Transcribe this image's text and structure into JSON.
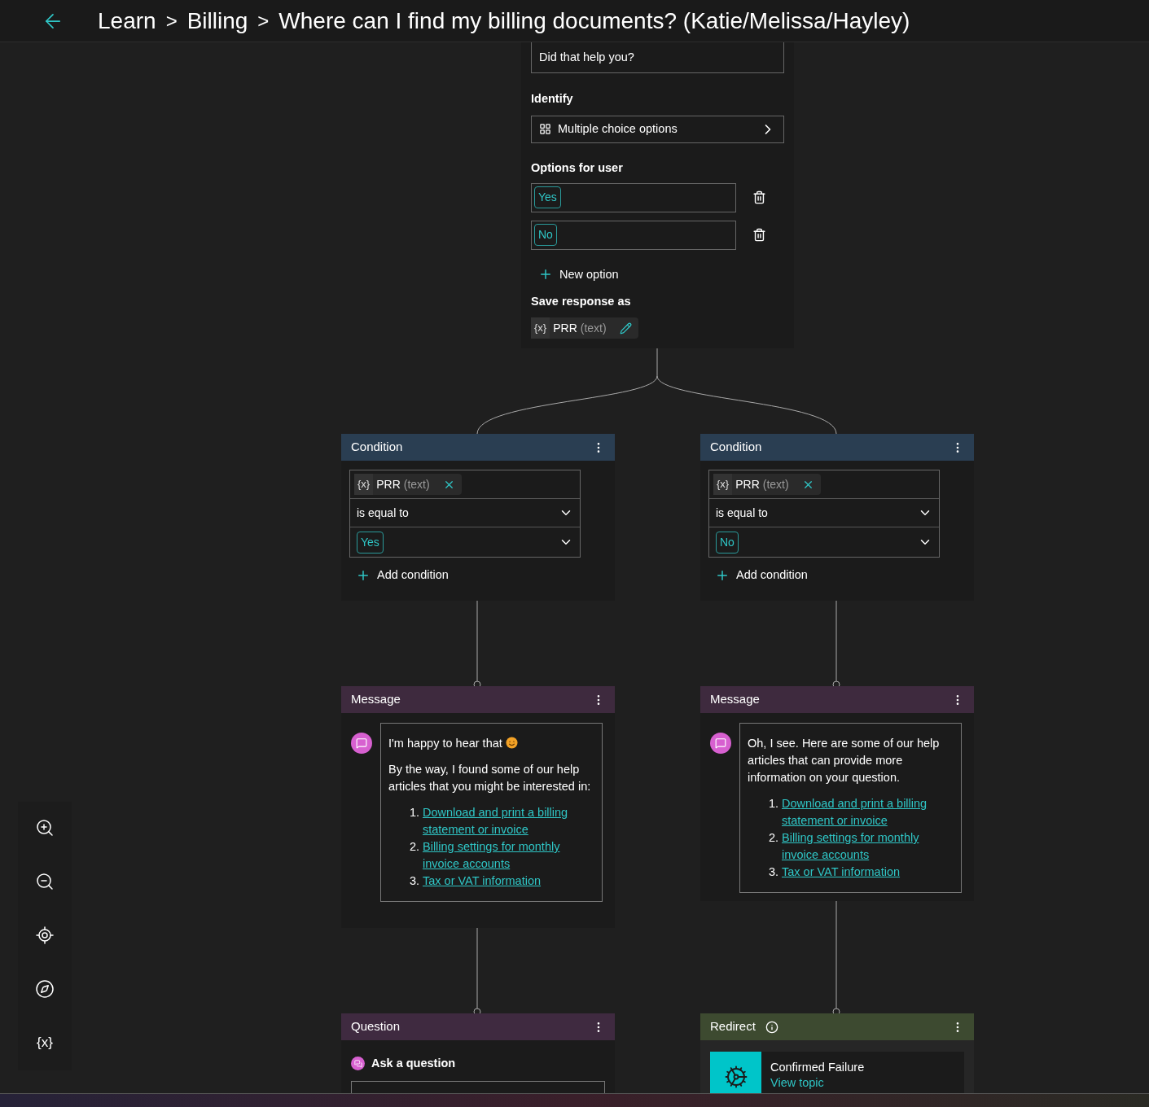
{
  "header": {
    "breadcrumb": [
      {
        "kind": "crumb",
        "text": "Learn"
      },
      {
        "kind": "separator",
        "text": ">"
      },
      {
        "kind": "crumb",
        "text": "Billing"
      },
      {
        "kind": "separator",
        "text": ">"
      },
      {
        "kind": "crumb",
        "text": "Where can I find my billing documents? (Katie/Melissa/Hayley)"
      }
    ]
  },
  "question_node": {
    "prompt": "Did that help you?",
    "identify_label": "Identify",
    "identify_value": "Multiple choice options",
    "options_label": "Options for user",
    "options": [
      "Yes",
      "No"
    ],
    "new_option": "New option",
    "save_label": "Save response as",
    "variable": {
      "icon_text": "{x}",
      "name": "PRR",
      "type": "(text)"
    }
  },
  "conditions": [
    {
      "title": "Condition",
      "variable": {
        "icon_text": "{x}",
        "name": "PRR",
        "type": "(text)"
      },
      "operator": "is equal to",
      "value": "Yes",
      "add": "Add condition"
    },
    {
      "title": "Condition",
      "variable": {
        "icon_text": "{x}",
        "name": "PRR",
        "type": "(text)"
      },
      "operator": "is equal to",
      "value": "No",
      "add": "Add condition"
    }
  ],
  "messages": [
    {
      "title": "Message",
      "paragraphs": [
        {
          "text": "I'm happy to hear that",
          "emoji": true
        },
        {
          "text": "By the way, I found some of our help articles that you might be interested in:",
          "emoji": false
        }
      ],
      "links": [
        {
          "number": "1.",
          "text": "Download and print a billing statement or invoice"
        },
        {
          "number": "2.",
          "text": "Billing settings for monthly invoice accounts"
        },
        {
          "number": "3.",
          "text": "Tax or VAT information"
        }
      ]
    },
    {
      "title": "Message",
      "paragraphs": [
        {
          "text": "Oh, I see. Here are some of our help articles that can provide more information on your question.",
          "emoji": false
        }
      ],
      "links": [
        {
          "number": "1.",
          "text": "Download and print a billing statement or invoice"
        },
        {
          "number": "2.",
          "text": "Billing settings for monthly invoice accounts"
        },
        {
          "number": "3.",
          "text": "Tax or VAT information"
        }
      ]
    }
  ],
  "question": {
    "title": "Question",
    "label": "Ask a question"
  },
  "redirect": {
    "title": "Redirect",
    "topic": "Confirmed Failure",
    "link": "View topic"
  },
  "toolbar": {
    "variables_label": "{x}"
  }
}
